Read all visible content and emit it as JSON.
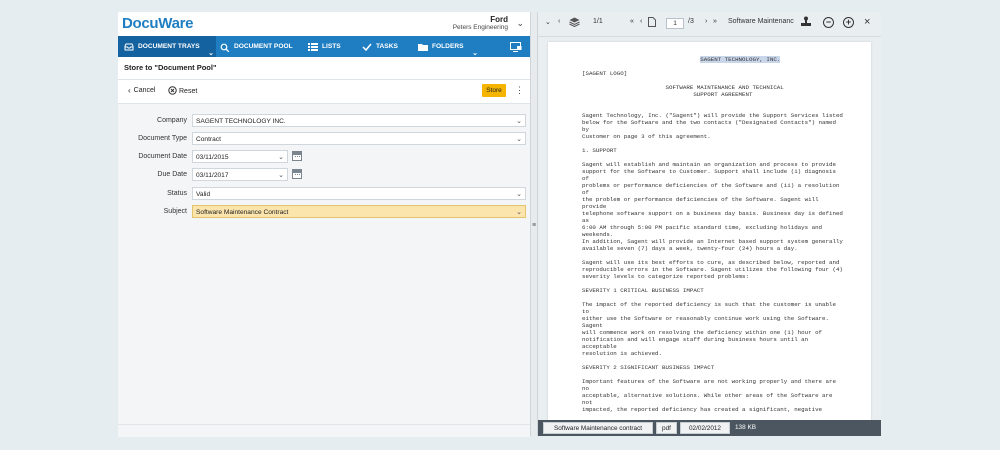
{
  "header": {
    "logo": "DocuWare",
    "user_name": "Ford",
    "user_org": "Peters Engineering"
  },
  "nav": {
    "tabs": [
      {
        "label": "DOCUMENT TRAYS",
        "icon": "tray-icon"
      },
      {
        "label": "DOCUMENT POOL",
        "icon": "search-icon"
      },
      {
        "label": "LISTS",
        "icon": "list-icon"
      },
      {
        "label": "TASKS",
        "icon": "check-icon"
      },
      {
        "label": "FOLDERS",
        "icon": "folder-icon"
      }
    ]
  },
  "store_title": "Store to \"Document Pool\"",
  "toolbar": {
    "cancel": "Cancel",
    "reset": "Reset",
    "store": "Store"
  },
  "form": {
    "company": {
      "label": "Company",
      "value": "SAGENT TECHNOLOGY INC."
    },
    "doctype": {
      "label": "Document Type",
      "value": "Contract"
    },
    "docdate": {
      "label": "Document Date",
      "value": "03/11/2015"
    },
    "duedate": {
      "label": "Due Date",
      "value": "03/11/2017"
    },
    "status": {
      "label": "Status",
      "value": "Valid"
    },
    "subject": {
      "label": "Subject",
      "value": "Software Maintenance Contract"
    }
  },
  "viewer": {
    "page_of": "1/1",
    "page_input": "1",
    "page_total": "/3",
    "doc_title": "Software Maintenanc",
    "document_text": [
      "SAGENT TECHNOLOGY, INC.",
      "",
      "[SAGENT LOGO]",
      "",
      "                        SOFTWARE MAINTENANCE AND TECHNICAL",
      "                                SUPPORT AGREEMENT",
      "",
      "",
      "Sagent Technology, Inc. (\"Sagent\") will provide the Support Services listed",
      "below for the Software and the two contacts (\"Designated Contacts\") named",
      "by",
      "Customer on page 3 of this agreement.",
      "",
      "1. SUPPORT",
      "",
      "Sagent will establish and maintain an organization and process to provide",
      "support for the Software to Customer. Support shall include (i) diagnosis",
      "of",
      "problems or performance deficiencies of the Software and (ii) a resolution",
      "of",
      "the problem or performance deficiencies of the Software. Sagent will",
      "provide",
      "telephone software support on a business day basis. Business day is defined",
      "as",
      "6:00 AM through 5:00 PM pacific standard time, excluding holidays and",
      "weekends.",
      "In addition, Sagent will provide an Internet based support system generally",
      "available seven (7) days a week, twenty-four (24) hours a day.",
      "",
      "Sagent will use its best efforts to cure, as described below, reported and",
      "reproducible errors in the Software. Sagent utilizes the following four (4)",
      "severity levels to categorize reported problems:",
      "",
      "SEVERITY 1 CRITICAL BUSINESS IMPACT",
      "",
      "The impact of the reported deficiency is such that the customer is unable",
      "to",
      "either use the Software or reasonably continue work using the Software.",
      "Sagent",
      "will commence work on resolving the deficiency within one (1) hour of",
      "notification and will engage staff during business hours until an",
      "acceptable",
      "resolution is achieved.",
      "",
      "SEVERITY 2 SIGNIFICANT BUSINESS IMPACT",
      "",
      "Important features of the Software are not working properly and there are",
      "no",
      "acceptable, alternative solutions. While other areas of the Software are",
      "not",
      "impacted, the reported deficiency has created a significant, negative"
    ]
  },
  "statusbar": {
    "name": "Software Maintenance contract",
    "ext": "pdf",
    "date": "02/02/2012",
    "size": "138 KB"
  }
}
